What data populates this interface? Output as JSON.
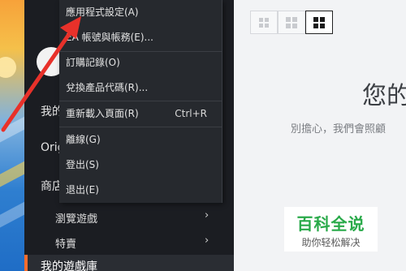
{
  "menu": {
    "items": [
      {
        "label": "應用程式設定(A)"
      },
      {
        "label": "EA 帳號與帳務(E)..."
      },
      {
        "label": "訂購記錄(O)"
      },
      {
        "label": "兌換產品代碼(R)..."
      },
      {
        "label": "重新載入頁面(R)",
        "shortcut": "Ctrl+R"
      },
      {
        "label": "離線(G)"
      },
      {
        "label": "登出(S)"
      },
      {
        "label": "退出(E)"
      }
    ]
  },
  "sidebar": {
    "my": "我的",
    "origin": "Orig",
    "store": "商店",
    "browse_games": "瀏覽遊戲",
    "deals": "特賣",
    "my_game_library": "我的遊戲庫"
  },
  "main": {
    "heading": "您的",
    "subtext": "別擔心，我們會照顧"
  },
  "watermark": {
    "title": "百科全说",
    "subtitle": "助你轻松解决"
  },
  "colors": {
    "accent": "#f56c2d",
    "annotation_arrow": "#e8312a",
    "watermark_green": "#2aaa4a"
  }
}
